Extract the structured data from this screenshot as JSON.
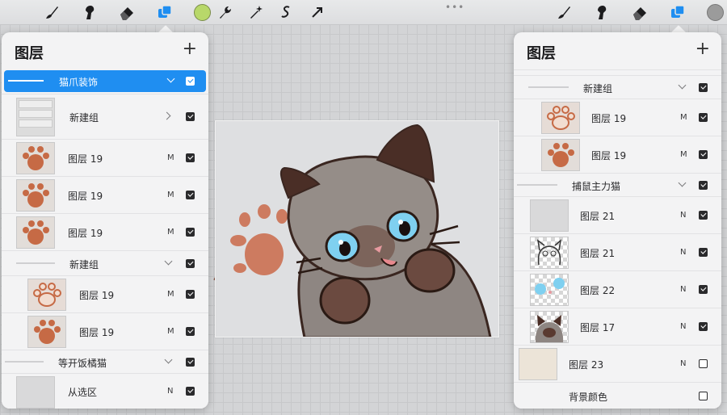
{
  "toolbar": {
    "left_icons": [
      "brush-icon",
      "smudge-icon",
      "eraser-icon",
      "layers-icon",
      "color-swatch"
    ],
    "mid_icons": [
      "wrench-icon",
      "magic-wand-icon",
      "selection-icon",
      "transform-icon"
    ],
    "right_icons": [
      "brush-icon",
      "smudge-icon",
      "eraser-icon",
      "layers-icon",
      "color-swatch"
    ],
    "more_dots": "•••",
    "left_color": "#b8d86a",
    "right_color": "#9b9b9b",
    "active_color": "#1f8ef1"
  },
  "left_panel": {
    "title": "图层",
    "add": "+",
    "rows": [
      {
        "type": "group",
        "name": "猫爪装饰",
        "mode": "",
        "checked": true,
        "selected": true,
        "chevron": "down"
      },
      {
        "type": "layer",
        "name": "新建组",
        "mode": "",
        "checked": true,
        "selected": false,
        "chevron": "right",
        "thumb": "group-collapsed"
      },
      {
        "type": "layer",
        "name": "图层 19",
        "mode": "M",
        "checked": true,
        "thumb": "paw-solid"
      },
      {
        "type": "layer",
        "name": "图层 19",
        "mode": "M",
        "checked": true,
        "thumb": "paw-solid"
      },
      {
        "type": "layer",
        "name": "图层 19",
        "mode": "M",
        "checked": true,
        "thumb": "paw-solid"
      },
      {
        "type": "group",
        "name": "新建组",
        "mode": "",
        "checked": true,
        "chevron": "down"
      },
      {
        "type": "layer",
        "name": "图层 19",
        "mode": "M",
        "checked": true,
        "thumb": "paw-outline",
        "indent": true
      },
      {
        "type": "layer",
        "name": "图层 19",
        "mode": "M",
        "checked": true,
        "thumb": "paw-solid",
        "indent": true
      },
      {
        "type": "group",
        "name": "等开饭橘猫",
        "mode": "",
        "checked": true,
        "chevron": "down"
      },
      {
        "type": "layer",
        "name": "从选区",
        "mode": "N",
        "checked": true,
        "thumb": "blank"
      }
    ]
  },
  "right_panel": {
    "title": "图层",
    "add": "+",
    "rows": [
      {
        "type": "group",
        "name": "新建组",
        "mode": "",
        "checked": true,
        "chevron": "down"
      },
      {
        "type": "layer",
        "name": "图层 19",
        "mode": "M",
        "checked": true,
        "thumb": "paw-outline",
        "indent": true
      },
      {
        "type": "layer",
        "name": "图层 19",
        "mode": "M",
        "checked": true,
        "thumb": "paw-solid",
        "indent": true
      },
      {
        "type": "group",
        "name": "捕鼠主力猫",
        "mode": "",
        "checked": true,
        "chevron": "down"
      },
      {
        "type": "layer",
        "name": "图层 21",
        "mode": "N",
        "checked": true,
        "thumb": "blank"
      },
      {
        "type": "layer",
        "name": "图层 21",
        "mode": "N",
        "checked": true,
        "thumb": "cat-sketch"
      },
      {
        "type": "layer",
        "name": "图层 22",
        "mode": "N",
        "checked": true,
        "thumb": "blue-eyes"
      },
      {
        "type": "layer",
        "name": "图层 17",
        "mode": "N",
        "checked": true,
        "thumb": "cat-color"
      },
      {
        "type": "layer",
        "name": "图层 23",
        "mode": "N",
        "checked": false,
        "thumb": "cream"
      },
      {
        "type": "background",
        "name": "背景颜色",
        "mode": "",
        "checked": false
      }
    ]
  }
}
